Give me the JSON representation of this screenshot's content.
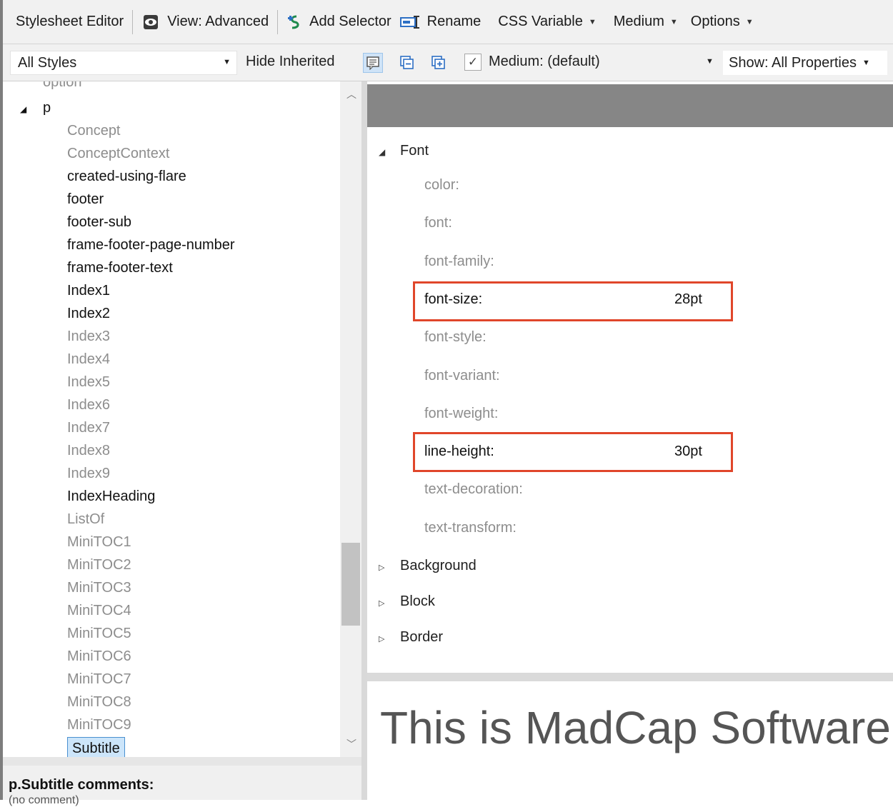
{
  "toolbar": {
    "title": "Stylesheet Editor",
    "view": "View: Advanced",
    "add_selector": "Add Selector",
    "rename": "Rename",
    "css_variable": "CSS Variable",
    "medium": "Medium",
    "options": "Options"
  },
  "toolbar2": {
    "styles_filter": "All Styles",
    "hide_inherited": "Hide Inherited",
    "medium_checked": true,
    "medium_label": "Medium: (default)",
    "show_properties": "Show: All Properties"
  },
  "tree": {
    "partial_top": "option",
    "parent": "p",
    "children": [
      {
        "label": "Concept",
        "inherited": true
      },
      {
        "label": "ConceptContext",
        "inherited": true
      },
      {
        "label": "created-using-flare",
        "inherited": false
      },
      {
        "label": "footer",
        "inherited": false
      },
      {
        "label": "footer-sub",
        "inherited": false
      },
      {
        "label": "frame-footer-page-number",
        "inherited": false
      },
      {
        "label": "frame-footer-text",
        "inherited": false
      },
      {
        "label": "Index1",
        "inherited": false
      },
      {
        "label": "Index2",
        "inherited": false
      },
      {
        "label": "Index3",
        "inherited": true
      },
      {
        "label": "Index4",
        "inherited": true
      },
      {
        "label": "Index5",
        "inherited": true
      },
      {
        "label": "Index6",
        "inherited": true
      },
      {
        "label": "Index7",
        "inherited": true
      },
      {
        "label": "Index8",
        "inherited": true
      },
      {
        "label": "Index9",
        "inherited": true
      },
      {
        "label": "IndexHeading",
        "inherited": false
      },
      {
        "label": "ListOf",
        "inherited": true
      },
      {
        "label": "MiniTOC1",
        "inherited": true
      },
      {
        "label": "MiniTOC2",
        "inherited": true
      },
      {
        "label": "MiniTOC3",
        "inherited": true
      },
      {
        "label": "MiniTOC4",
        "inherited": true
      },
      {
        "label": "MiniTOC5",
        "inherited": true
      },
      {
        "label": "MiniTOC6",
        "inherited": true
      },
      {
        "label": "MiniTOC7",
        "inherited": true
      },
      {
        "label": "MiniTOC8",
        "inherited": true
      },
      {
        "label": "MiniTOC9",
        "inherited": true
      },
      {
        "label": "Subtitle",
        "inherited": false,
        "selected": true
      }
    ]
  },
  "comments": {
    "title": "p.Subtitle comments:",
    "value": "(no comment)"
  },
  "properties": {
    "font_group": "Font",
    "font_props": [
      {
        "name": "color:",
        "value": ""
      },
      {
        "name": "font:",
        "value": ""
      },
      {
        "name": "font-family:",
        "value": ""
      },
      {
        "name": "font-size:",
        "value": "28pt"
      },
      {
        "name": "font-style:",
        "value": ""
      },
      {
        "name": "font-variant:",
        "value": ""
      },
      {
        "name": "font-weight:",
        "value": ""
      },
      {
        "name": "line-height:",
        "value": "30pt"
      },
      {
        "name": "text-decoration:",
        "value": ""
      },
      {
        "name": "text-transform:",
        "value": ""
      }
    ],
    "collapsed_groups": [
      "Background",
      "Block",
      "Border"
    ]
  },
  "preview": {
    "text": "This is MadCap Software"
  },
  "colors": {
    "highlight_box": "#e0462a",
    "selection": "#cce5fa",
    "inherited_text": "#8d8d8d"
  }
}
